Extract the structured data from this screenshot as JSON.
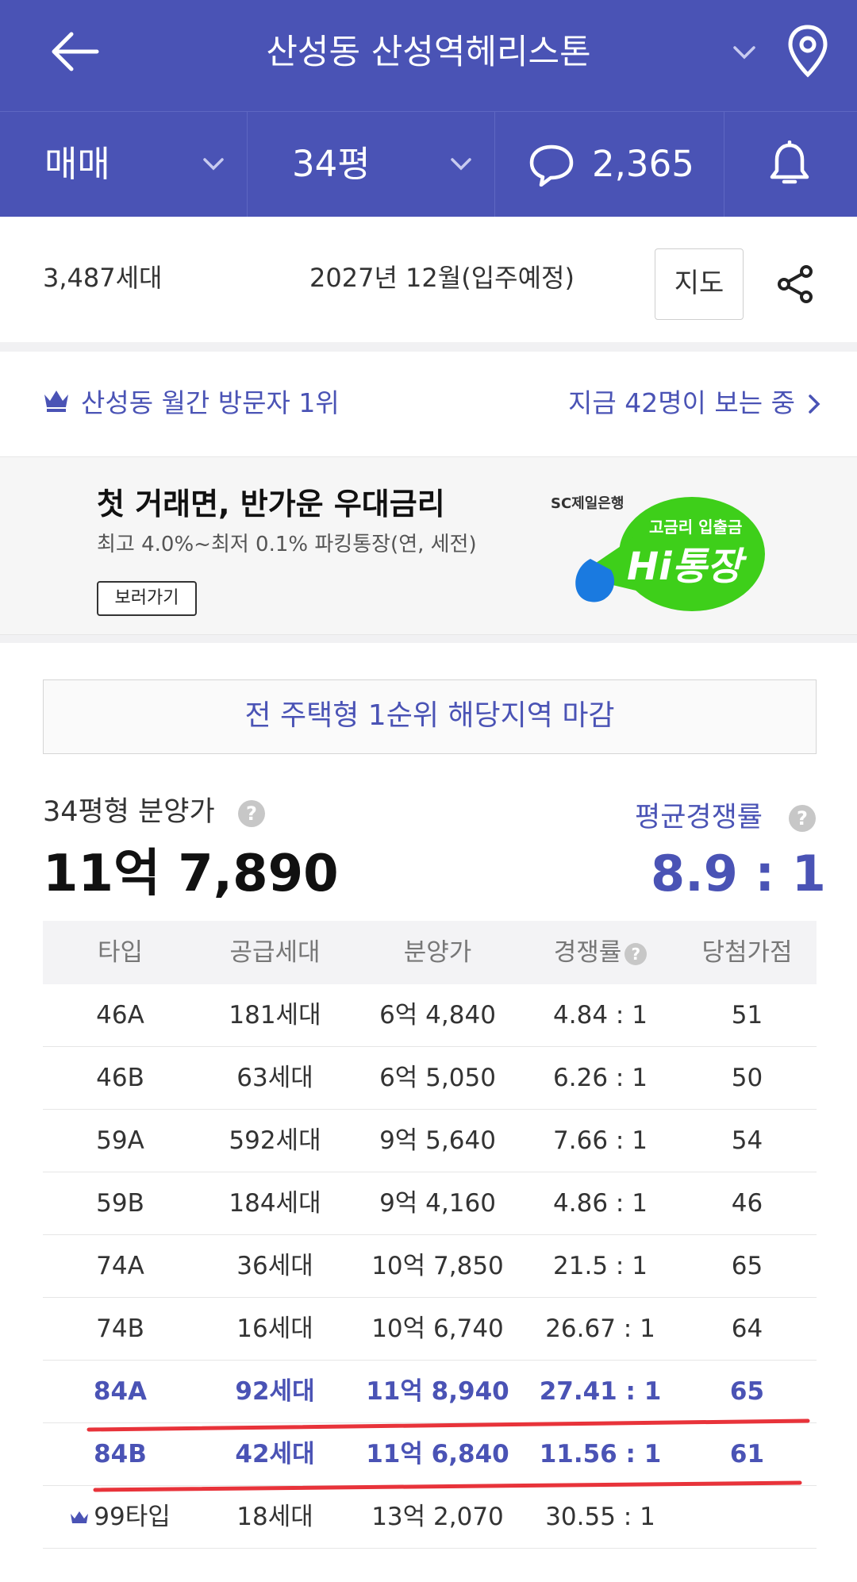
{
  "header": {
    "title": "산성동 산성역헤리스톤"
  },
  "subbar": {
    "trade_type": "매매",
    "size": "34평",
    "comment_count": "2,365"
  },
  "info": {
    "units": "3,487세대",
    "move_in": "2027년 12월(입주예정)",
    "map_label": "지도"
  },
  "rank": {
    "text": "산성동 월간 방문자 1위",
    "viewers": "지금 42명이 보는 중"
  },
  "ad": {
    "headline": "첫 거래면, 반가운 우대금리",
    "description": "최고 4.0%~최저 0.1% 파킹통장(연, 세전)",
    "cta": "보러가기",
    "bank": "SC제일은행",
    "logo_sub": "고금리 입출금",
    "logo_main": "Hi통장"
  },
  "notice": "전 주택형 1순위 해당지역 마감",
  "price": {
    "label": "34평형 분양가",
    "value": "11억 7,890",
    "comp_label": "평균경쟁률",
    "comp_value": "8.9 : 1"
  },
  "table": {
    "headers": [
      "타입",
      "공급세대",
      "분양가",
      "경쟁률",
      "당첨가점"
    ],
    "rows": [
      {
        "type": "46A",
        "units": "181세대",
        "price": "6억 4,840",
        "comp": "4.84 : 1",
        "score": "51",
        "highlight": false
      },
      {
        "type": "46B",
        "units": "63세대",
        "price": "6억 5,050",
        "comp": "6.26 : 1",
        "score": "50",
        "highlight": false
      },
      {
        "type": "59A",
        "units": "592세대",
        "price": "9억 5,640",
        "comp": "7.66 : 1",
        "score": "54",
        "highlight": false
      },
      {
        "type": "59B",
        "units": "184세대",
        "price": "9억 4,160",
        "comp": "4.86 : 1",
        "score": "46",
        "highlight": false
      },
      {
        "type": "74A",
        "units": "36세대",
        "price": "10억 7,850",
        "comp": "21.5 : 1",
        "score": "65",
        "highlight": false
      },
      {
        "type": "74B",
        "units": "16세대",
        "price": "10억 6,740",
        "comp": "26.67 : 1",
        "score": "64",
        "highlight": false
      },
      {
        "type": "84A",
        "units": "92세대",
        "price": "11억 8,940",
        "comp": "27.41 : 1",
        "score": "65",
        "highlight": true
      },
      {
        "type": "84B",
        "units": "42세대",
        "price": "11억 6,840",
        "comp": "11.56 : 1",
        "score": "61",
        "highlight": true
      },
      {
        "type": "99타입",
        "units": "18세대",
        "price": "13억 2,070",
        "comp": "30.55 : 1",
        "score": "",
        "highlight": false
      }
    ]
  },
  "colors": {
    "brand": "#4a53b5",
    "annotation_red": "#e8333a",
    "ad_green": "#3ecf1a",
    "ad_blue": "#1a7ae0"
  }
}
